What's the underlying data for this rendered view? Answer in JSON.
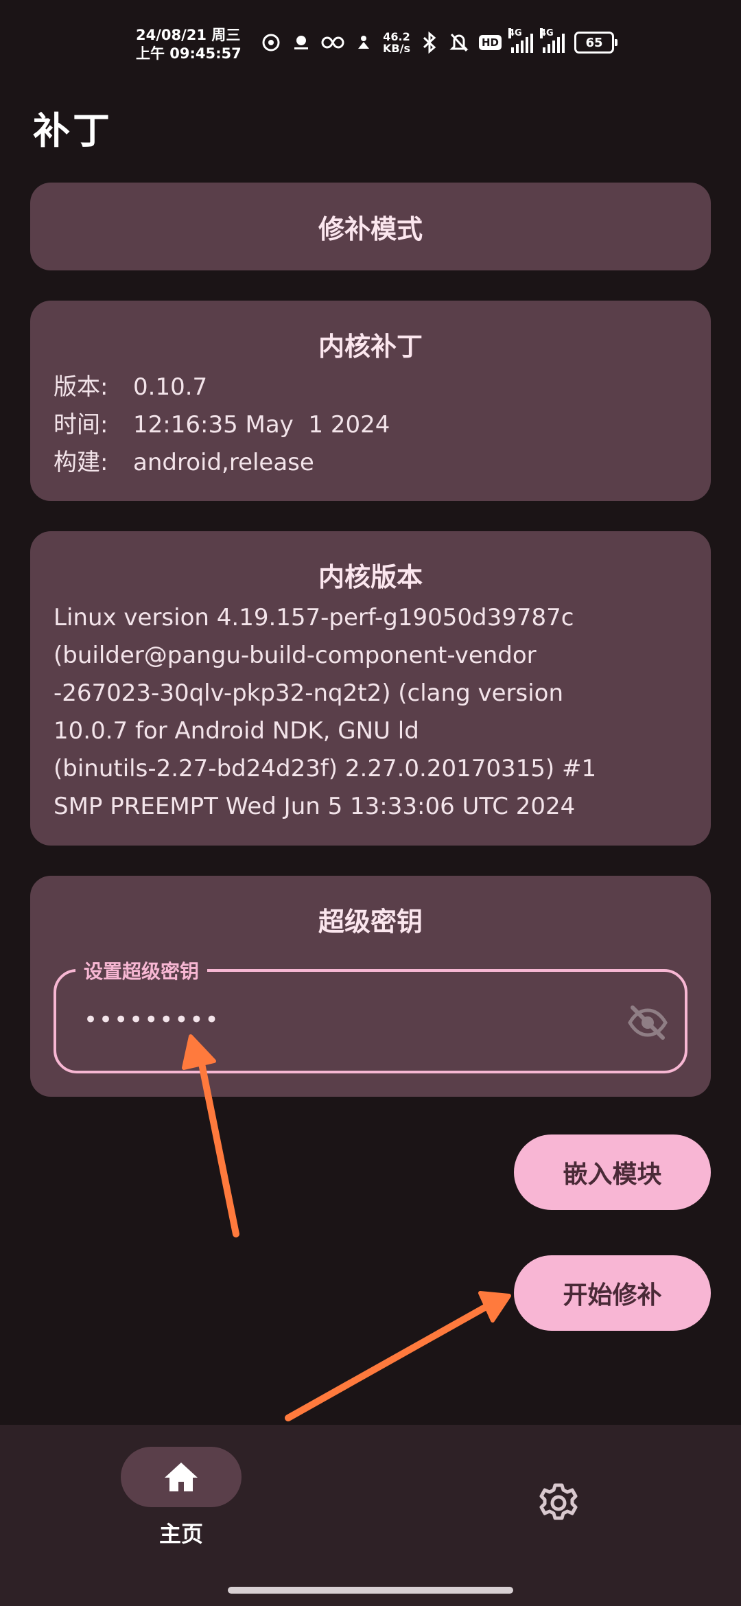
{
  "status_bar": {
    "date": "24/08/21 周三",
    "time": "上午 09:45:57",
    "net_speed_value": "46.2",
    "net_speed_unit": "KB/s",
    "hd_label": "HD",
    "signal1_label": "4G",
    "signal2_label": "4G",
    "battery_level": "65"
  },
  "app": {
    "title": "补丁"
  },
  "mode_card": {
    "label": "修补模式"
  },
  "patch_card": {
    "title": "内核补丁",
    "rows": [
      {
        "key": "版本:",
        "value": "0.10.7"
      },
      {
        "key": "时间:",
        "value": "12:16:35 May  1 2024"
      },
      {
        "key": "构建:",
        "value": "android,release"
      }
    ]
  },
  "kernel_card": {
    "title": "内核版本",
    "lines": [
      "Linux version 4.19.157-perf-g19050d39787c",
      "(builder@pangu-build-component-vendor",
      "-267023-30qlv-pkp32-nq2t2) (clang version",
      "10.0.7 for Android NDK, GNU ld",
      "(binutils-2.27-bd24d23f) 2.27.0.20170315) #1",
      "SMP PREEMPT Wed Jun 5 13:33:06 UTC 2024"
    ]
  },
  "superkey_card": {
    "title": "超级密钥",
    "field_label": "设置超级密钥",
    "field_value": "•••••••••"
  },
  "actions": {
    "embed_module": "嵌入模块",
    "start_patch": "开始修补"
  },
  "bottom_nav": {
    "home_label": "主页"
  },
  "colors": {
    "background": "#1b1416",
    "card": "#5a3f4a",
    "accent": "#f8b6d4",
    "annotation_arrow": "#ff7a3d"
  }
}
